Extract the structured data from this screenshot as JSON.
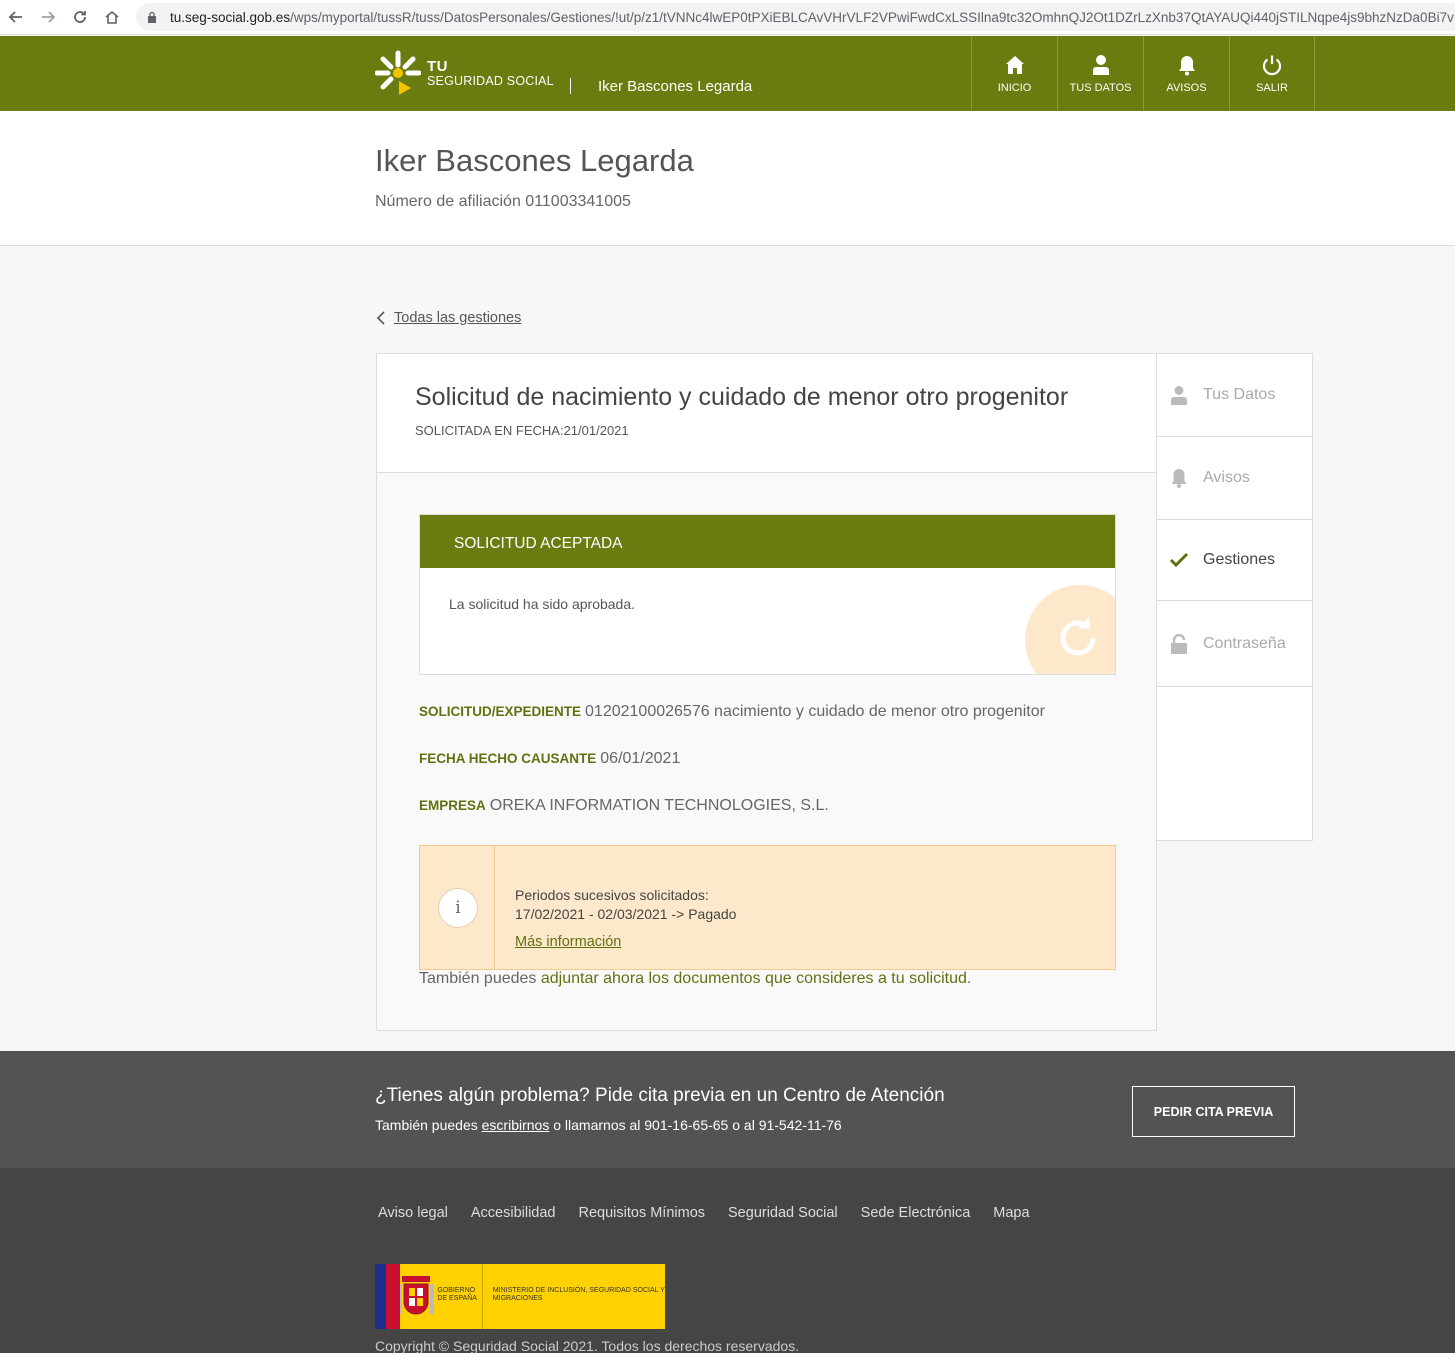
{
  "browser": {
    "url_host": "tu.seg-social.gob.es",
    "url_path": "/wps/myportal/tussR/tuss/DatosPersonales/Gestiones/!ut/p/z1/tVNNc4lwEP0tPXiEBLCAvVHrVLF2VPwiFwdCxLSSIlna9tc32OmhnQJ2Ot1DZrLzXnb37QtAYAUQi440jSTILNqpe4js9bhzNzDa0Bi7v"
  },
  "header": {
    "logo_tu": "TU",
    "logo_ss": "SEGURIDAD SOCIAL",
    "user_name": "Iker Bascones Legarda",
    "nav": [
      {
        "label": "INICIO",
        "icon": "home-icon"
      },
      {
        "label": "TUS DATOS",
        "icon": "user-icon"
      },
      {
        "label": "AVISOS",
        "icon": "bell-icon"
      },
      {
        "label": "SALIR",
        "icon": "power-icon"
      }
    ]
  },
  "profile": {
    "name": "Iker Bascones Legarda",
    "affiliation": "Número de afiliación 011003341005"
  },
  "back_link": "Todas las gestiones",
  "request": {
    "title": "Solicitud de nacimiento y cuidado de menor otro progenitor",
    "date": "SOLICITADA EN FECHA:21/01/2021",
    "status_title": "SOLICITUD ACEPTADA",
    "status_text": "La solicitud ha sido aprobada.",
    "fields": [
      {
        "label": "SOLICITUD/EXPEDIENTE",
        "value": "01202100026576 nacimiento y cuidado de menor otro progenitor"
      },
      {
        "label": "FECHA HECHO CAUSANTE",
        "value": "06/01/2021"
      },
      {
        "label": "EMPRESA",
        "value": "OREKA INFORMATION TECHNOLOGIES, S.L."
      }
    ],
    "info_icon": "i",
    "info_line1": "Periodos sucesivos solicitados:",
    "info_line2": "17/02/2021 - 02/03/2021 -> Pagado",
    "info_link": "Más información",
    "attach_prefix": "También puedes ",
    "attach_link": "adjuntar ahora los documentos que consideres a tu solicitud",
    "attach_suffix": "."
  },
  "side_menu": [
    {
      "label": "Tus Datos",
      "icon": "user-icon"
    },
    {
      "label": "Avisos",
      "icon": "bell-icon"
    },
    {
      "label": "Gestiones",
      "icon": "check-icon"
    },
    {
      "label": "Contraseña",
      "icon": "lock-icon"
    }
  ],
  "help": {
    "title": "¿Tienes algún problema? Pide cita previa en un Centro de Atención",
    "sub_prefix": "También puedes ",
    "sub_link": "escribirnos",
    "sub_suffix": " o llamarnos al 901-16-65-65 o al 91-542-11-76",
    "button": "PEDIR CITA PREVIA"
  },
  "footer": {
    "links": [
      "Aviso legal",
      "Accesibilidad",
      "Requisitos Mínimos",
      "Seguridad Social",
      "Sede Electrónica",
      "Mapa"
    ],
    "gov_text": "GOBIERNO DE ESPAÑA",
    "ministry_text": "MINISTERIO DE INCLUSIÓN, SEGURIDAD SOCIAL Y MIGRACIONES",
    "copyright": "Copyright © Seguridad Social 2021. Todos los derechos reservados."
  },
  "colors": {
    "brand_green": "#687c10",
    "label_green": "#5f720f",
    "info_bg": "#fde8cc",
    "footer_dark": "#454545"
  }
}
